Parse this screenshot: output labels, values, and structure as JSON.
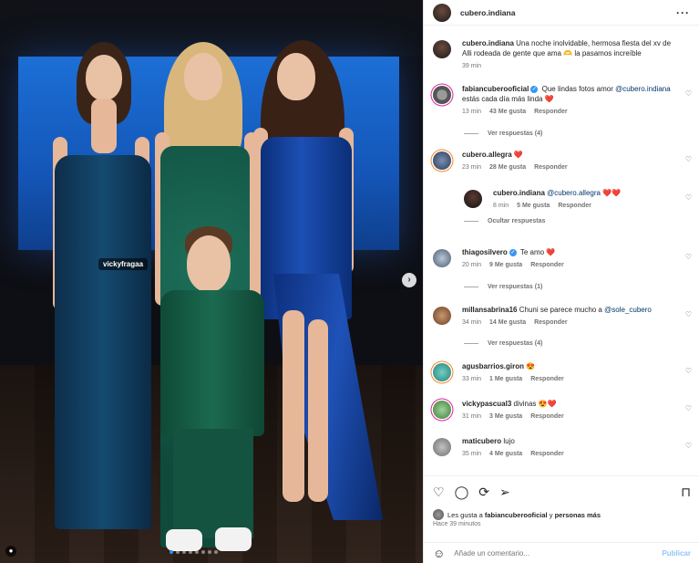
{
  "post": {
    "username": "cubero.indiana",
    "photo_tag": "vickyfragaa",
    "caption_user": "cubero.indiana",
    "caption_text": "Una noche inolvidable, hermosa fiesta del xv de Alli rodeada de gente que ama 🫶 la pasamos increíble",
    "caption_time": "39 min"
  },
  "comments": [
    {
      "user": "fabiancuberooficial",
      "verified": true,
      "text_before": "Que lindas fotos amor",
      "mention": "@cubero.indiana",
      "text_after": "estás cada día más linda ❤️",
      "time": "13 min",
      "likes": "43 Me gusta",
      "reply": "Responder",
      "replies": "Ver respuestas (4)"
    },
    {
      "user": "cubero.allegra",
      "text": "❤️",
      "time": "23 min",
      "likes": "28 Me gusta",
      "reply": "Responder"
    },
    {
      "user": "cubero.indiana",
      "mention": "@cubero.allegra",
      "text": "❤️❤️",
      "time": "8 min",
      "likes": "5 Me gusta",
      "reply": "Responder",
      "replies": "Ocultar respuestas"
    },
    {
      "user": "thiagosilvero",
      "verified": true,
      "text": "Te amo ❤️",
      "time": "20 min",
      "likes": "9 Me gusta",
      "reply": "Responder",
      "replies": "Ver respuestas (1)"
    },
    {
      "user": "millansabrina16",
      "text": "Chuni se parece mucho a",
      "mention": "@sole_cubero",
      "time": "34 min",
      "likes": "14 Me gusta",
      "reply": "Responder",
      "replies": "Ver respuestas (4)"
    },
    {
      "user": "agusbarrios.giron",
      "text": "😍",
      "time": "33 min",
      "likes": "1 Me gusta",
      "reply": "Responder"
    },
    {
      "user": "vickypascual3",
      "text": "divinas 😍❤️",
      "time": "31 min",
      "likes": "3 Me gusta",
      "reply": "Responder"
    },
    {
      "user": "maticubero",
      "text": "lujo",
      "time": "35 min",
      "likes": "4 Me gusta",
      "reply": "Responder"
    }
  ],
  "likes": {
    "prefix": "Les gusta a",
    "user": "fabiancuberooficial",
    "suffix": "y",
    "rest": "personas más"
  },
  "post_time": "Hace 39 minutos",
  "add_comment": {
    "placeholder": "Añade un comentario...",
    "post_label": "Publicar"
  },
  "icons": [
    "heart-icon",
    "comment-icon",
    "share-icon",
    "send-icon",
    "bookmark-icon",
    "emoji-icon",
    "more-icon"
  ]
}
